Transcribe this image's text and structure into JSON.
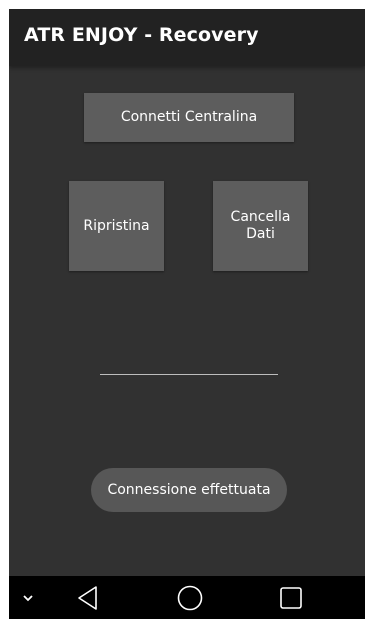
{
  "app": {
    "title": "ATR ENJOY - Recovery"
  },
  "buttons": {
    "connect_label": "Connetti Centralina",
    "restore_label": "Ripristina",
    "clear_label": "Cancella\nDati"
  },
  "toast": {
    "message": "Connessione effettuata"
  },
  "navigation": {
    "icons": [
      "chevron-down-icon",
      "back-icon",
      "home-icon",
      "recents-icon"
    ]
  },
  "colors": {
    "background": "#313131",
    "action_bar": "#222222",
    "button": "#5d5d5d",
    "nav_bar": "#000000",
    "text": "#ffffff"
  }
}
